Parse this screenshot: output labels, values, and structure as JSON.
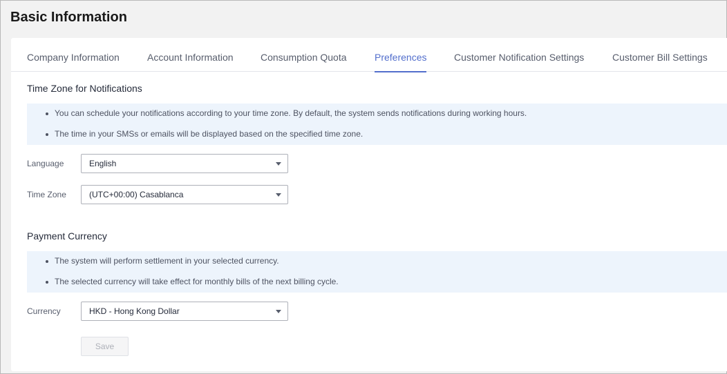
{
  "page": {
    "title": "Basic Information"
  },
  "tabs": [
    {
      "label": "Company Information",
      "active": false
    },
    {
      "label": "Account Information",
      "active": false
    },
    {
      "label": "Consumption Quota",
      "active": false
    },
    {
      "label": "Preferences",
      "active": true
    },
    {
      "label": "Customer Notification Settings",
      "active": false
    },
    {
      "label": "Customer Bill Settings",
      "active": false
    }
  ],
  "timezone_section": {
    "title": "Time Zone for Notifications",
    "notes": [
      "You can schedule your notifications according to your time zone. By default, the system sends notifications during working hours.",
      "The time in your SMSs or emails will be displayed based on the specified time zone."
    ],
    "language": {
      "label": "Language",
      "value": "English"
    },
    "timezone": {
      "label": "Time Zone",
      "value": "(UTC+00:00) Casablanca"
    }
  },
  "currency_section": {
    "title": "Payment Currency",
    "notes": [
      "The system will perform settlement in your selected currency.",
      "The selected currency will take effect for monthly bills of the next billing cycle."
    ],
    "currency": {
      "label": "Currency",
      "value": "HKD - Hong Kong Dollar"
    }
  },
  "actions": {
    "save_label": "Save"
  },
  "colors": {
    "accent": "#526ecc",
    "notice_bg": "#edf4fc",
    "page_bg": "#f2f2f2"
  }
}
